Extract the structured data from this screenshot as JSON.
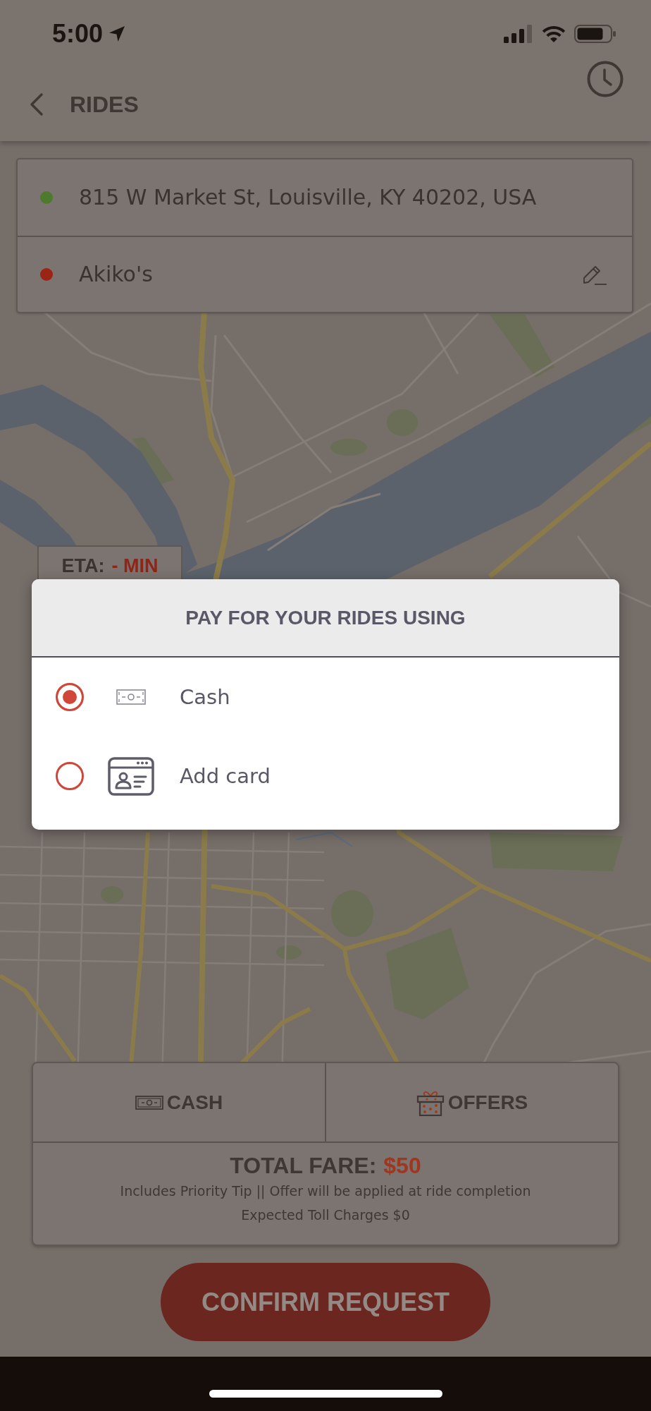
{
  "status_bar": {
    "time": "5:00"
  },
  "header": {
    "title": "RIDES"
  },
  "route": {
    "stops": [
      {
        "address": "815 W Market St, Louisville, KY 40202, USA",
        "color": "#4d7a2c",
        "editable": false
      },
      {
        "address": "Akiko's",
        "color": "#9c2414",
        "editable": true
      }
    ]
  },
  "eta": {
    "label": "ETA:",
    "value": "- MIN"
  },
  "payment_dialog": {
    "title": "PAY FOR YOUR RIDES USING",
    "options": [
      {
        "kind": "cash",
        "label": "Cash",
        "selected": true
      },
      {
        "kind": "card",
        "label": "Add card",
        "selected": false
      }
    ]
  },
  "fare_panel": {
    "tabs": [
      {
        "kind": "cash",
        "label": "CASH"
      },
      {
        "kind": "offers",
        "label": "OFFERS"
      }
    ],
    "total_label": "TOTAL FARE:",
    "total_value": "$50",
    "notes": [
      "Includes Priority Tip || Offer will be applied at ride completion",
      "Expected Toll Charges $0"
    ]
  },
  "confirm_button": {
    "label": "CONFIRM REQUEST"
  }
}
